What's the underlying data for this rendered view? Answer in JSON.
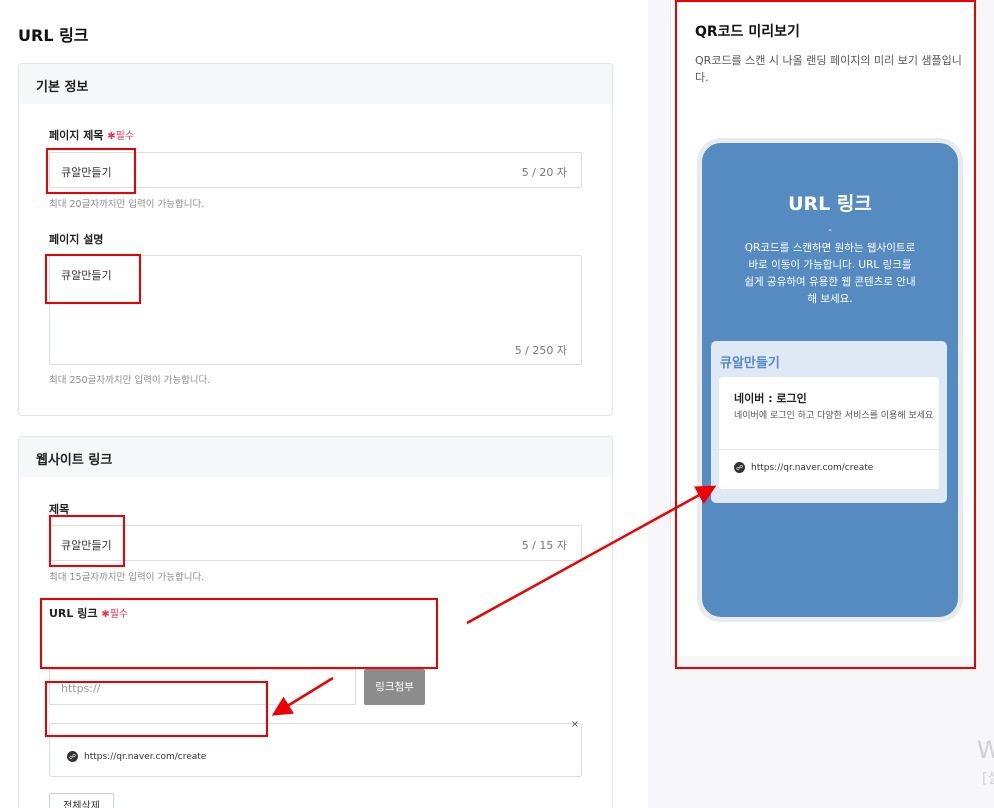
{
  "page": {
    "title": "URL 링크"
  },
  "basic_info": {
    "header": "기본 정보",
    "title_field": {
      "label": "페이지 제목",
      "required_mark": "✱",
      "required_text": "필수",
      "value": "큐알만들기",
      "count": "5 / 20 자",
      "hint": "최대 20글자까지만 입력이 가능합니다."
    },
    "desc_field": {
      "label": "페이지 설명",
      "value": "큐알만들기",
      "count": "5 / 250 자",
      "hint": "최대 250글자까지만 입력이 가능합니다."
    }
  },
  "website_link": {
    "header": "웹사이트 링크",
    "title_field": {
      "label": "제목",
      "value": "큐알만들기",
      "count": "5 / 15 자",
      "hint": "최대 15글자까지만 입력이 가능합니다."
    },
    "url_field": {
      "label": "URL 링크",
      "required_mark": "✱",
      "required_text": "필수",
      "placeholder": "https://",
      "attach_button": "링크첨부"
    },
    "attached_link": {
      "url": "https://qr.naver.com/create",
      "close": "×"
    },
    "delete_all_button": "전체삭제"
  },
  "preview": {
    "title": "QR코드 미리보기",
    "description": "QR코드를 스캔 시 나올 랜딩 페이지의 미리 보기 샘플입니다.",
    "phone": {
      "title": "URL 링크",
      "dash": "-",
      "description": "QR코드를 스캔하면 원하는 웹사이트로 바로 이동이 가능합니다. URL 링크를 쉽게 공유하여 유용한 웹 콘텐츠로 안내해 보세요.",
      "card_title": "큐알만들기",
      "link_title": "네이버 : 로그인",
      "link_desc": "네이버에 로그인 하고 다양한 서비스를 이용해 보세요",
      "link_url": "https://qr.naver.com/create"
    }
  },
  "watermark": {
    "line1": "W",
    "line2": "[설"
  },
  "colors": {
    "accent": "#558bc0",
    "highlight": "#e00000",
    "required": "#e8344e"
  },
  "icons": {
    "link": "link-icon",
    "close": "close-icon"
  }
}
